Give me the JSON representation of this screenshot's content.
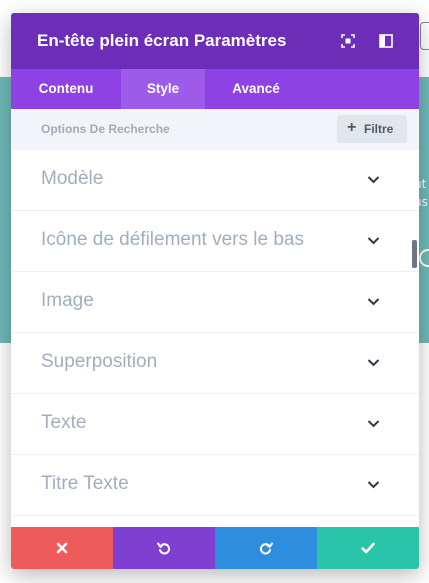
{
  "background": {
    "accent_color": "#6fb9b9",
    "side_text_lines": [
      "ut",
      "us"
    ]
  },
  "modal": {
    "title": "En-tête plein écran Paramètres",
    "header_color": "#6c2eb9",
    "header_icons": [
      "expand-icon",
      "sidebar-toggle-icon"
    ],
    "tabs": [
      {
        "label": "Contenu",
        "active": false
      },
      {
        "label": "Style",
        "active": true
      },
      {
        "label": "Avancé",
        "active": false
      }
    ],
    "search": {
      "placeholder": "Options De Recherche",
      "filter_label": "Filtre",
      "filter_icon": "plus-icon"
    },
    "sections": [
      {
        "label": "Modèle"
      },
      {
        "label": "Icône de défilement vers le bas"
      },
      {
        "label": "Image"
      },
      {
        "label": "Superposition"
      },
      {
        "label": "Texte"
      },
      {
        "label": "Titre Texte"
      }
    ],
    "footer": {
      "buttons": [
        {
          "name": "cancel",
          "icon": "close-icon",
          "color": "#ef5a5a"
        },
        {
          "name": "undo",
          "icon": "undo-icon",
          "color": "#7f3fd0"
        },
        {
          "name": "redo",
          "icon": "redo-icon",
          "color": "#2d8ee0"
        },
        {
          "name": "save",
          "icon": "check-icon",
          "color": "#29c4a9"
        }
      ]
    }
  }
}
